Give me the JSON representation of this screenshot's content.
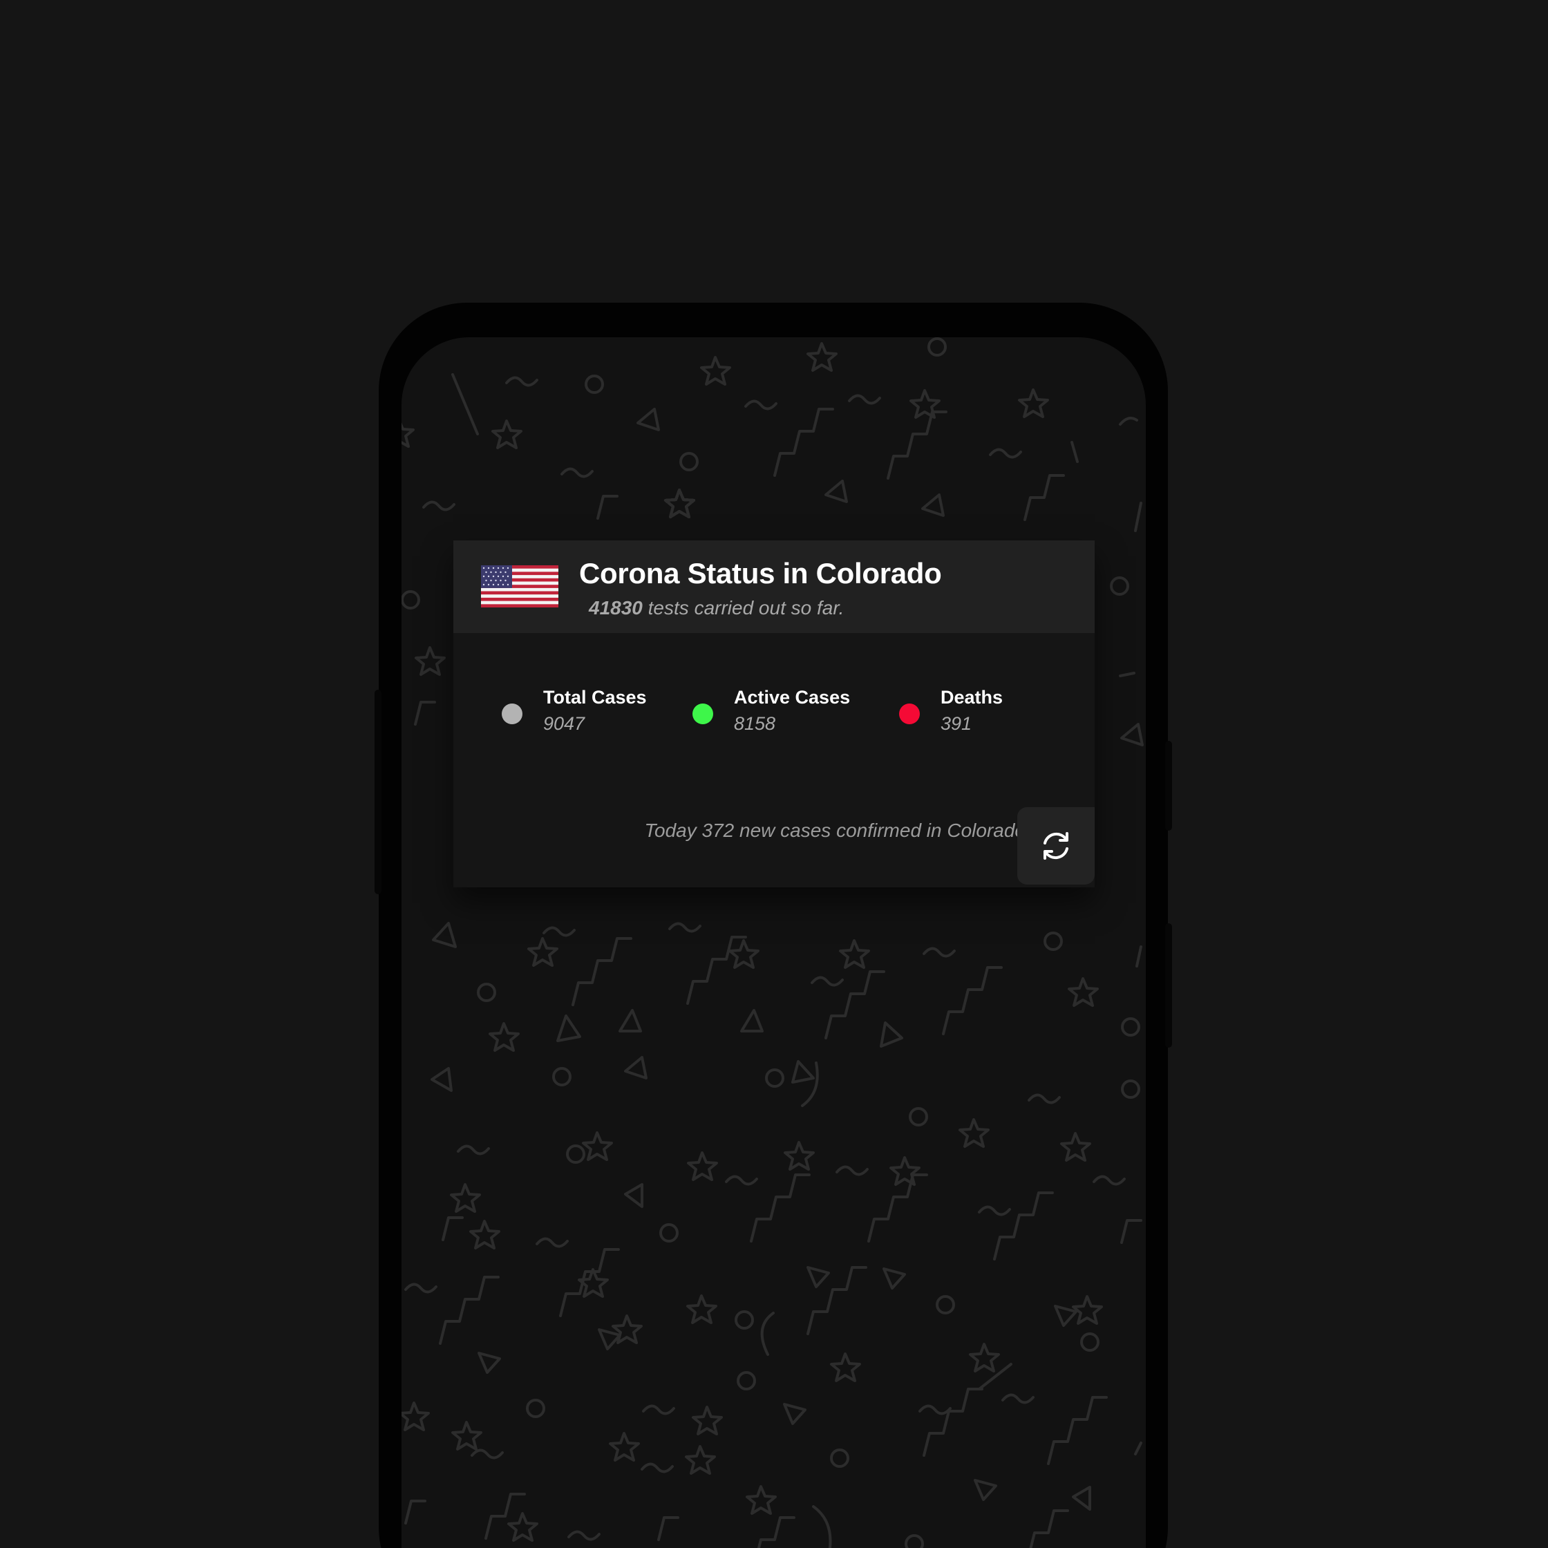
{
  "header": {
    "title": "Corona Status in Colorado",
    "tests_count": "41830",
    "tests_suffix": "tests carried out so far.",
    "flag_icon": "us-flag-icon"
  },
  "stats": [
    {
      "label": "Total Cases",
      "value": "9047",
      "color": "#b3b3b3"
    },
    {
      "label": "Active Cases",
      "value": "8158",
      "color": "#3ef64a"
    },
    {
      "label": "Deaths",
      "value": "391",
      "color": "#f50a35"
    }
  ],
  "footer": {
    "today_text": "Today 372 new cases confirmed in Colorado",
    "refresh_icon": "refresh-icon"
  },
  "colors": {
    "background": "#151515",
    "card": "#151515",
    "card_header": "#212121",
    "button": "#232323"
  }
}
